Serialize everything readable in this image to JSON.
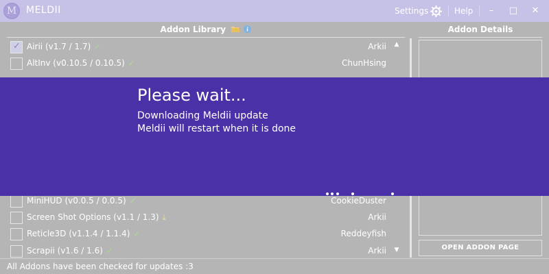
{
  "titlebar": {
    "logo_letter": "M",
    "app_title": "MELDII",
    "settings": "Settings",
    "help": "Help",
    "minimize": "–",
    "maximize": "□",
    "close": "✕"
  },
  "library": {
    "heading": "Addon Library",
    "addons": [
      {
        "name": "Airii (v1.7 / 1.7)",
        "author": "Arkii",
        "checked": true,
        "status": "ok"
      },
      {
        "name": "AltInv (v0.10.5 / 0.10.5)",
        "author": "ChunHsing",
        "checked": false,
        "status": "ok"
      },
      {
        "name": "MiniHUD (v0.0.5 / 0.0.5)",
        "author": "CookieDuster",
        "checked": false,
        "status": "ok"
      },
      {
        "name": "Screen Shot Options (v1.1 / 1.3)",
        "author": "Arkii",
        "checked": false,
        "status": "update"
      },
      {
        "name": "Reticle3D (v1.1.4 / 1.1.4)",
        "author": "Reddeyfish",
        "checked": false,
        "status": "ok"
      },
      {
        "name": "Scrapii (v1.6 / 1.6)",
        "author": "Arkii",
        "checked": false,
        "status": "ok"
      }
    ]
  },
  "details": {
    "heading": "Addon Details",
    "open_button": "OPEN ADDON PAGE"
  },
  "status_bar": {
    "text": "All Addons have been checked for updates :3"
  },
  "overlay": {
    "title": "Please wait...",
    "line1": "Downloading Meldii update",
    "line2": "Meldii will restart when it is done"
  },
  "icons": {
    "settings": "gear-icon",
    "folder": "folder-icon",
    "info": "info-icon",
    "ok": "check-icon",
    "update": "download-icon"
  },
  "colors": {
    "titlebar": "#c6c1e6",
    "background": "#b5b5b5",
    "overlay": "#4b31a8",
    "ok": "#a8e08c",
    "update": "#f2e68a"
  }
}
